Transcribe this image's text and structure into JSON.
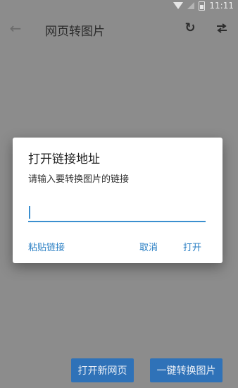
{
  "status_bar": {
    "time": "11:11"
  },
  "app_bar": {
    "title": "网页转图片"
  },
  "dialog": {
    "title": "打开链接地址",
    "message": "请输入要转换图片的链接",
    "input_value": "",
    "paste_label": "粘贴链接",
    "cancel_label": "取消",
    "open_label": "打开"
  },
  "bottom": {
    "open_new_label": "打开新网页",
    "convert_label": "一键转换图片"
  },
  "colors": {
    "accent": "#3b8fcf",
    "button_bg": "#2f72b8",
    "overlay": "#8c8c8c"
  }
}
